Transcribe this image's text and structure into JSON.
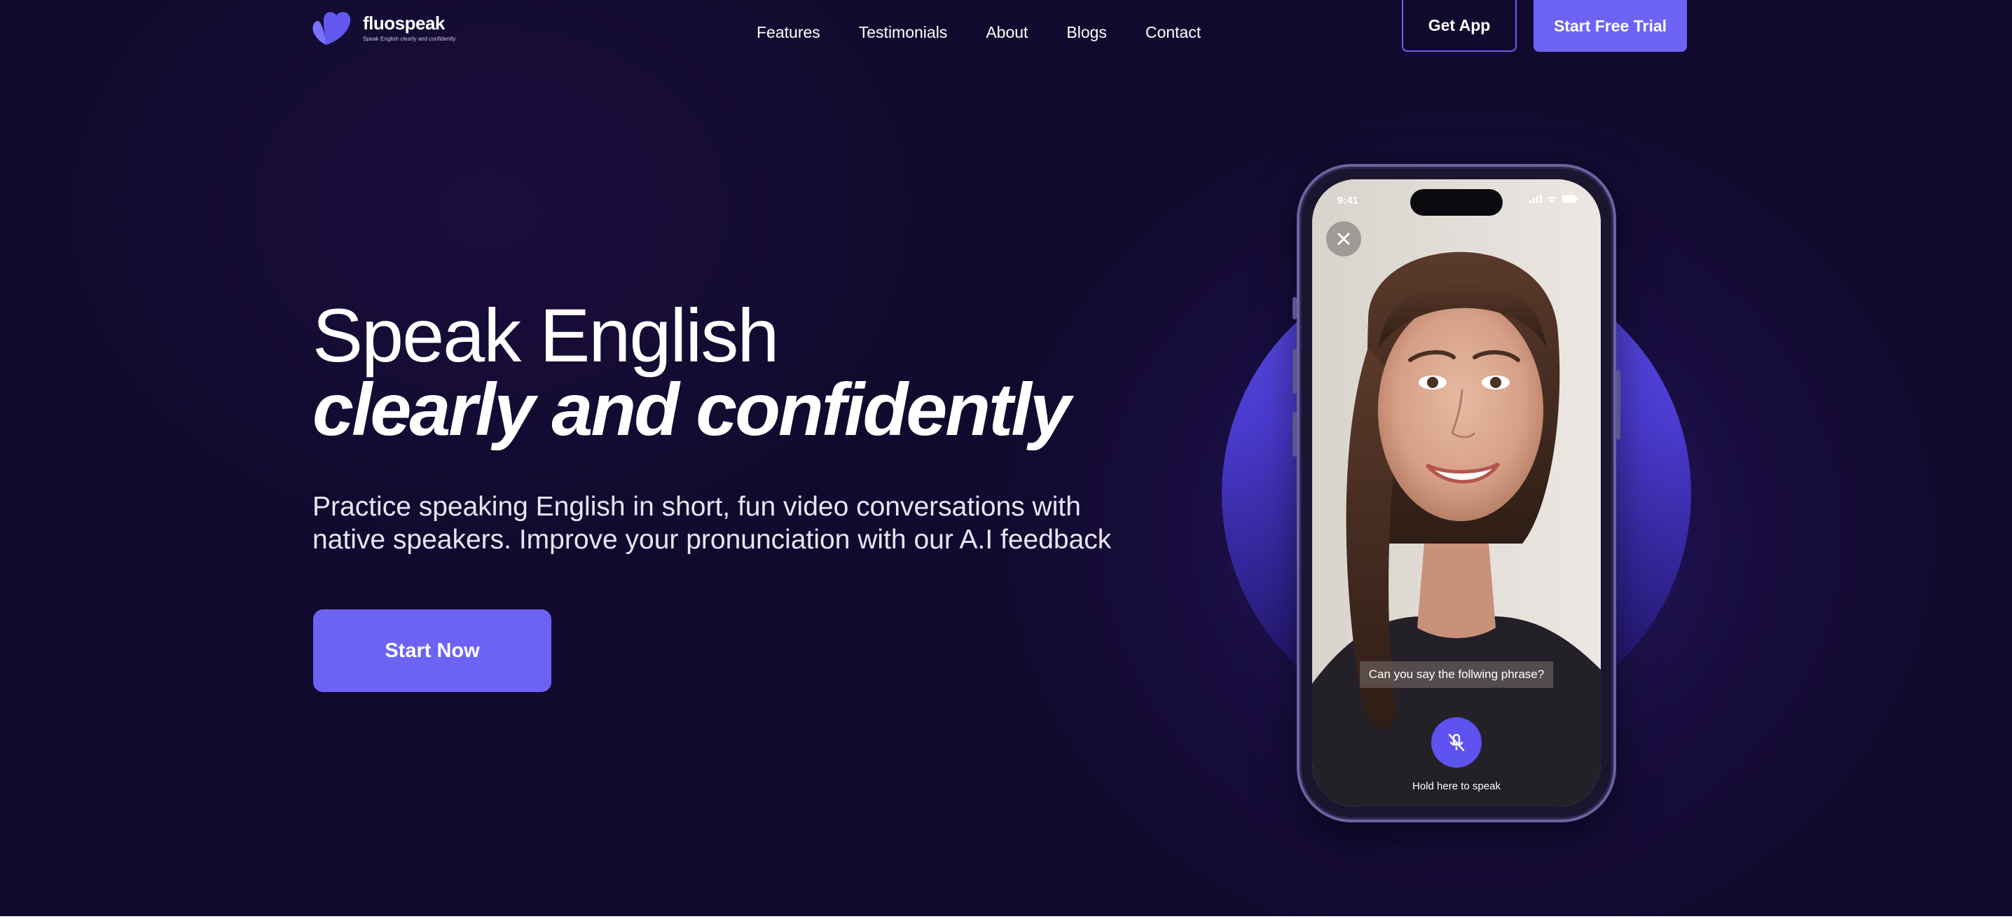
{
  "brand": {
    "name": "fluospeak",
    "tagline": "Speak English clearly and confidently",
    "color": "#6c63f5"
  },
  "nav": {
    "items": [
      {
        "label": "Features"
      },
      {
        "label": "Testimonials"
      },
      {
        "label": "About"
      },
      {
        "label": "Blogs"
      },
      {
        "label": "Contact"
      }
    ],
    "get_app_label": "Get App",
    "trial_label": "Start Free Trial"
  },
  "hero": {
    "headline_line1": "Speak English",
    "headline_line2": "clearly and confidently",
    "subtext": "Practice speaking English in short, fun video conversations with native speakers. Improve your pronunciation with our A.I feedback",
    "cta_label": "Start Now"
  },
  "phone": {
    "time": "9:41",
    "caption": "Can you say the follwing phrase?",
    "hold_label": "Hold here to speak",
    "icons": [
      "close-icon",
      "microphone-off-icon",
      "signal-icon",
      "wifi-icon",
      "battery-icon"
    ]
  },
  "colors": {
    "background": "#120a2e",
    "accent": "#6c63f5",
    "glow": "#5a4be6"
  }
}
